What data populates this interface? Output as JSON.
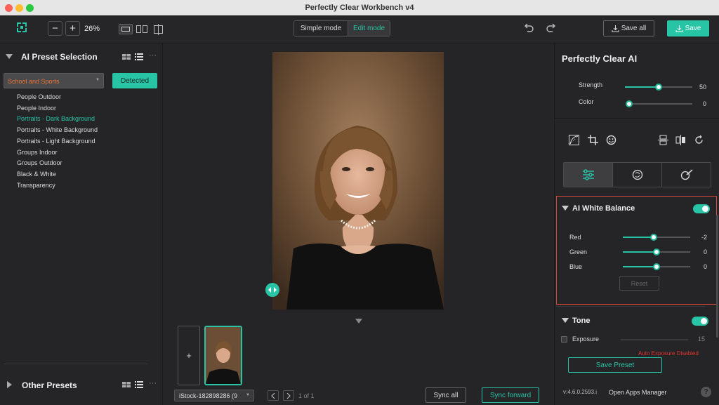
{
  "window": {
    "title": "Perfectly Clear Workbench v4"
  },
  "toolbar": {
    "zoom_minus": "−",
    "zoom_plus": "+",
    "zoom_level": "26%",
    "modes": [
      "Simple mode",
      "Edit mode"
    ],
    "active_mode": "Edit mode",
    "save_all": "Save all",
    "save": "Save"
  },
  "left_panel": {
    "ai_preset_title": "AI Preset Selection",
    "category_selected": "School and Sports",
    "detected_label": "Detected",
    "presets": [
      "People Outdoor",
      "People Indoor",
      "Portraits - Dark Background",
      "Portraits - White Background",
      "Portraits - Light Background",
      "Groups Indoor",
      "Groups Outdoor",
      "Black & White",
      "Transparency"
    ],
    "active_preset": "Portraits - Dark Background",
    "other_presets_title": "Other Presets",
    "more": "···"
  },
  "filmstrip": {
    "add": "+",
    "file_select": "iStock-182898286 (9",
    "page_info": "1 of 1",
    "sync_all": "Sync all",
    "sync_forward": "Sync forward"
  },
  "right_panel": {
    "title": "Perfectly Clear AI",
    "strength": {
      "label": "Strength",
      "value": "50",
      "level": 0.5
    },
    "color": {
      "label": "Color",
      "value": "0",
      "level": 0.0
    },
    "white_balance": {
      "title": "AI White Balance",
      "enabled": true,
      "sliders": [
        {
          "label": "Red",
          "value": "-2",
          "level": 0.46
        },
        {
          "label": "Green",
          "value": "0",
          "level": 0.5
        },
        {
          "label": "Blue",
          "value": "0",
          "level": 0.5
        }
      ],
      "reset": "Reset"
    },
    "tone": {
      "title": "Tone",
      "enabled": true,
      "exposure_label": "Exposure",
      "exposure_value": "15",
      "warning": "Auto Exposure Disabled"
    },
    "save_preset": "Save Preset",
    "version": "v:4.6.0.2593.i",
    "open_apps": "Open Apps Manager",
    "help": "?"
  },
  "colors": {
    "accent": "#27c4a6",
    "highlight_border": "#e04a3a",
    "category_text": "#e8743a",
    "warning": "#e03030"
  }
}
